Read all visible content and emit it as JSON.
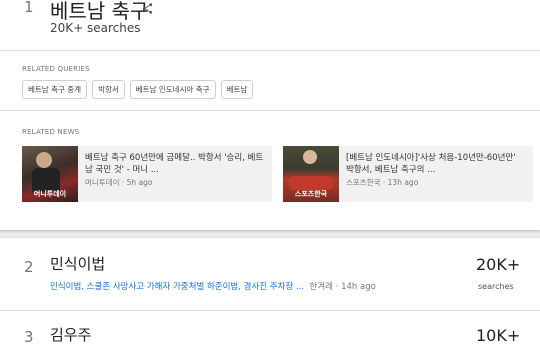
{
  "trend1": {
    "rank": "1",
    "title": "베트남 축구",
    "searches": "20K+ searches",
    "related_queries_label": "RELATED QUERIES",
    "queries": [
      "베트남 축구 중계",
      "박항서",
      "베트남 인도네시아 축구",
      "베트남"
    ],
    "related_news_label": "RELATED NEWS",
    "news": [
      {
        "title": "베트남 축구 60년만에 금메달.. 박항서 '승리, 베트남 국민 것' - 머니 ...",
        "source": "머니투데이",
        "time": "5h ago",
        "thumb_caption": "머니투데이"
      },
      {
        "title": "[베트남 인도네시아]'사상 처음-10년만-60년만' 박항서, 베트남 축구의 ...",
        "source": "스포츠한국",
        "time": "13h ago",
        "thumb_caption": "스포츠한국"
      }
    ]
  },
  "trend2": {
    "rank": "2",
    "title": "민식이법",
    "subtitle": "민식이법, 스쿨존 사망사고 가해자 가중처벌 하준이법, 경사진 주차장 ...",
    "source": "한겨레",
    "time": "14h ago",
    "count": "20K+",
    "count_label": "searches"
  },
  "trend3": {
    "rank": "3",
    "title": "김우주",
    "count": "10K+"
  },
  "icons": {
    "share": "share-icon"
  }
}
